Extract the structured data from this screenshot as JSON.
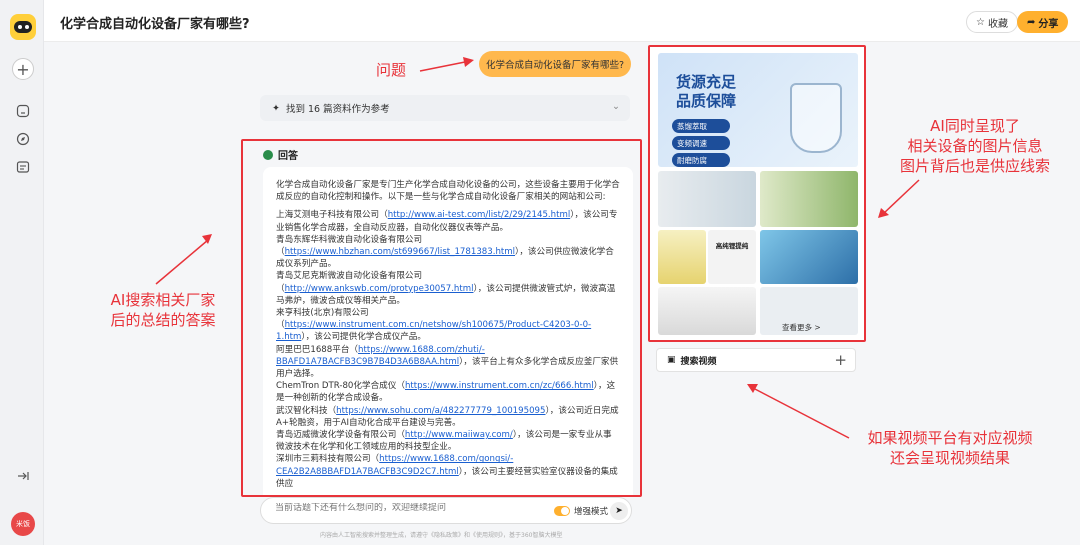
{
  "app": {
    "title": "化学合成自动化设备厂家有哪些?",
    "fav_label": "收藏",
    "share_label": "分享"
  },
  "sidebar": {
    "avatar_text": "米饭"
  },
  "question": {
    "text": "化学合成自动化设备厂家有哪些?"
  },
  "refs": {
    "label": "找到 16 篇资料作为参考"
  },
  "answer": {
    "heading": "回答",
    "intro": "化学合成自动化设备厂家是专门生产化学合成自动化设备的公司，这些设备主要用于化学合成反应的自动化控制和操作。以下是一些与化学合成自动化设备厂家相关的网站和公司:",
    "companies": [
      {
        "pre": "上海艾测电子科技有限公司（",
        "url": "http://www.ai-test.com/list/2/29/2145.html",
        "post": "），该公司专业销售化学合成器，全自动反应器，自动化仪器仪表等产品。"
      },
      {
        "pre": "青岛东辉华科微波自动化设备有限公司（",
        "url": "https://www.hbzhan.com/st699667/list_1781383.html",
        "post": "），该公司供应微波化学合成仪系列产品。"
      },
      {
        "pre": "青岛艾尼克斯微波自动化设备有限公司（",
        "url": "http://www.ankswb.com/protype30057.html",
        "post": "），该公司提供微波管式炉，微波高温马弗炉，微波合成仪等相关产品。"
      },
      {
        "pre": "来亨科技(北京)有限公司（",
        "url": "https://www.instrument.com.cn/netshow/sh100675/Product-C4203-0-0-1.htm",
        "post": "），该公司提供化学合成仪产品。"
      },
      {
        "pre": "阿里巴巴1688平台（",
        "url": "https://www.1688.com/zhuti/-BBAFD1A7BACFB3C9B7B4D3A6B8AA.html",
        "post": "），该平台上有众多化学合成反应釜厂家供用户选择。"
      },
      {
        "pre": "ChemTron DTR-80化学合成仪（",
        "url": "https://www.instrument.com.cn/zc/666.html",
        "post": "），这是一种创新的化学合成设备。"
      },
      {
        "pre": "武汉智化科技（",
        "url": "https://www.sohu.com/a/482277779_100195095",
        "post": "），该公司近日完成A+轮融资，用于AI自动化合成平台建设与完善。"
      },
      {
        "pre": "青岛迈威微波化学设备有限公司（",
        "url": "http://www.maiiway.com/",
        "post": "），该公司是一家专业从事微波技术在化学和化工领域应用的科技型企业。"
      },
      {
        "pre": "深圳市三莉科技有限公司（",
        "url": "https://www.1688.com/gongsi/-CEA2B2A8BBAFD1A7BACFB3C9D2C7.html",
        "post": "），该公司主要经营实验室仪器设备的集成供应"
      }
    ]
  },
  "input": {
    "placeholder": "当前话题下还有什么想问的，欢迎继续提问",
    "mode_label": "增强模式"
  },
  "footer": {
    "text": "内容由人工智能搜索并整理生成，请遵守《隐私政策》和《使用规则》，基于360智脑大模型"
  },
  "images": {
    "main_text_line1": "货源充足",
    "main_text_line2": "品质保障",
    "badges": [
      "蒸馏萃取",
      "变频调速",
      "耐磨防腐"
    ],
    "thumb_caption": "高纯锂提纯",
    "more_label": "查看更多 >"
  },
  "video": {
    "label": "搜索视频"
  },
  "annotations": {
    "question": "问题",
    "answer": "AI搜索相关厂家\n后的总结的答案",
    "images": "AI同时呈现了\n相关设备的图片信息\n图片背后也是供应线索",
    "video": "如果视频平台有对应视频\n还会呈现视频结果"
  },
  "colors": {
    "accent": "#ffb02e",
    "annotation_red": "#e8333a",
    "link": "#1a5fd0"
  }
}
